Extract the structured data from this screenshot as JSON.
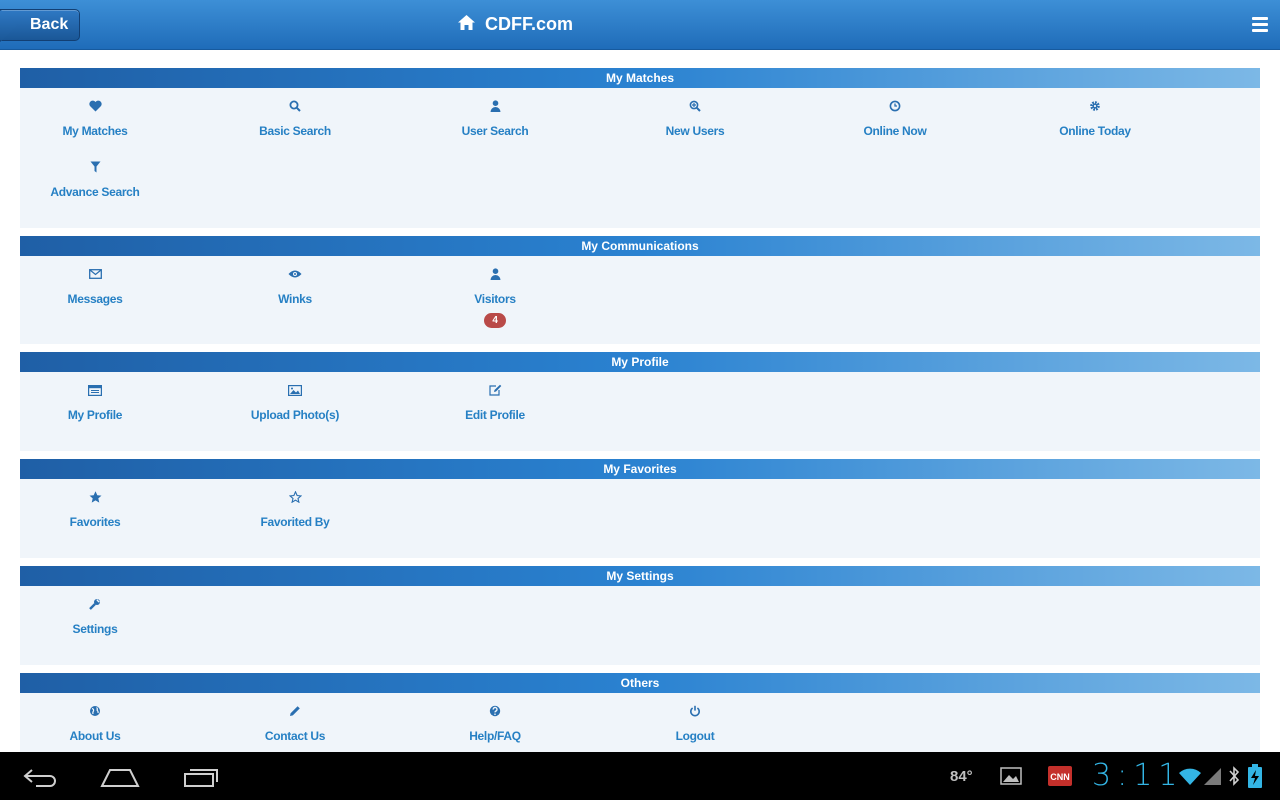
{
  "header": {
    "back_label": "Back",
    "home_icon": "home-icon",
    "title": "CDFF.com",
    "menu_icon": "hamburger-menu-icon"
  },
  "sections": [
    {
      "title": "My Matches",
      "items": [
        {
          "label": "My Matches",
          "icon": "heart-icon"
        },
        {
          "label": "Basic Search",
          "icon": "search-icon"
        },
        {
          "label": "User Search",
          "icon": "user-icon"
        },
        {
          "label": "New Users",
          "icon": "zoom-in-icon"
        },
        {
          "label": "Online Now",
          "icon": "clock-icon"
        },
        {
          "label": "Online Today",
          "icon": "gear-icon"
        },
        {
          "label": "Advance Search",
          "icon": "filter-icon"
        }
      ]
    },
    {
      "title": "My Communications",
      "items": [
        {
          "label": "Messages",
          "icon": "envelope-icon"
        },
        {
          "label": "Winks",
          "icon": "eye-icon"
        },
        {
          "label": "Visitors",
          "icon": "user-icon",
          "badge": "4"
        }
      ]
    },
    {
      "title": "My Profile",
      "items": [
        {
          "label": "My Profile",
          "icon": "id-card-icon"
        },
        {
          "label": "Upload Photo(s)",
          "icon": "picture-icon"
        },
        {
          "label": "Edit Profile",
          "icon": "edit-icon"
        }
      ]
    },
    {
      "title": "My Favorites",
      "items": [
        {
          "label": "Favorites",
          "icon": "star-icon"
        },
        {
          "label": "Favorited By",
          "icon": "star-outline-icon"
        }
      ]
    },
    {
      "title": "My Settings",
      "items": [
        {
          "label": "Settings",
          "icon": "wrench-icon"
        }
      ]
    },
    {
      "title": "Others",
      "items": [
        {
          "label": "About Us",
          "icon": "globe-icon"
        },
        {
          "label": "Contact Us",
          "icon": "pencil-icon"
        },
        {
          "label": "Help/FAQ",
          "icon": "question-icon"
        },
        {
          "label": "Logout",
          "icon": "power-icon"
        }
      ]
    }
  ],
  "system_bar": {
    "temperature": "84°",
    "time": "3:11"
  },
  "colors": {
    "accent": "#2680c4",
    "header_blue": "#1f6cb9",
    "badge": "#b94a48",
    "clock": "#33b5e5"
  }
}
